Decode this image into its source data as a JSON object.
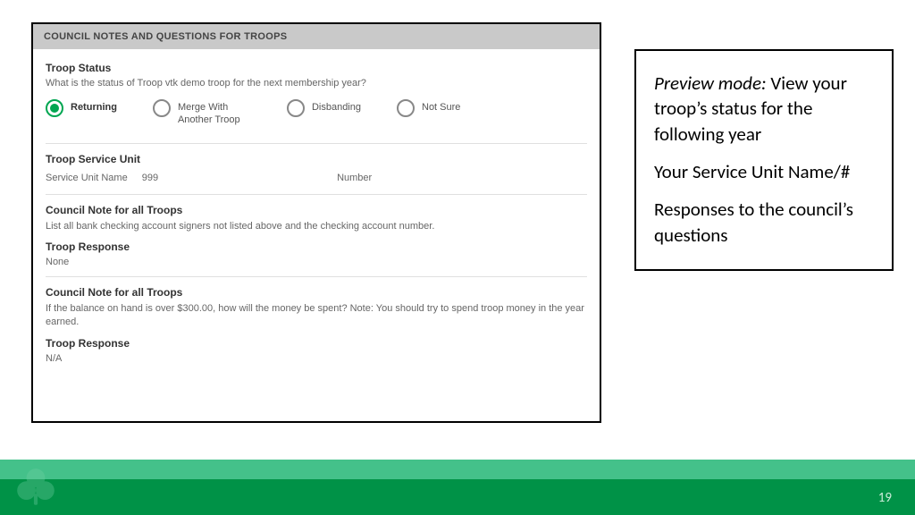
{
  "form": {
    "header": "COUNCIL NOTES AND QUESTIONS FOR TROOPS",
    "troop_status": {
      "label": "Troop Status",
      "question": "What is the status of Troop vtk demo troop for the next membership year?",
      "options": {
        "returning": "Returning",
        "merge": "Merge With Another Troop",
        "disbanding": "Disbanding",
        "notsure": "Not Sure"
      }
    },
    "service_unit": {
      "label": "Troop Service Unit",
      "name_label": "Service Unit Name",
      "name_value": "999",
      "number_label": "Number"
    },
    "council_note1": {
      "label": "Council Note for all Troops",
      "text": "List all bank checking account signers not listed above and the checking account number.",
      "response_label": "Troop Response",
      "response_value": "None"
    },
    "council_note2": {
      "label": "Council Note for all Troops",
      "text": "If the balance on hand is over $300.00, how will the money be spent? Note: You should try to spend troop money in the year earned.",
      "response_label": "Troop Response",
      "response_value": "N/A"
    }
  },
  "callout": {
    "line1_lead": "Preview mode: ",
    "line1_rest": "View your troop’s status for the following year",
    "line2": "Your Service Unit Name/#",
    "line3": "Responses to the council’s questions"
  },
  "page_number": "19"
}
